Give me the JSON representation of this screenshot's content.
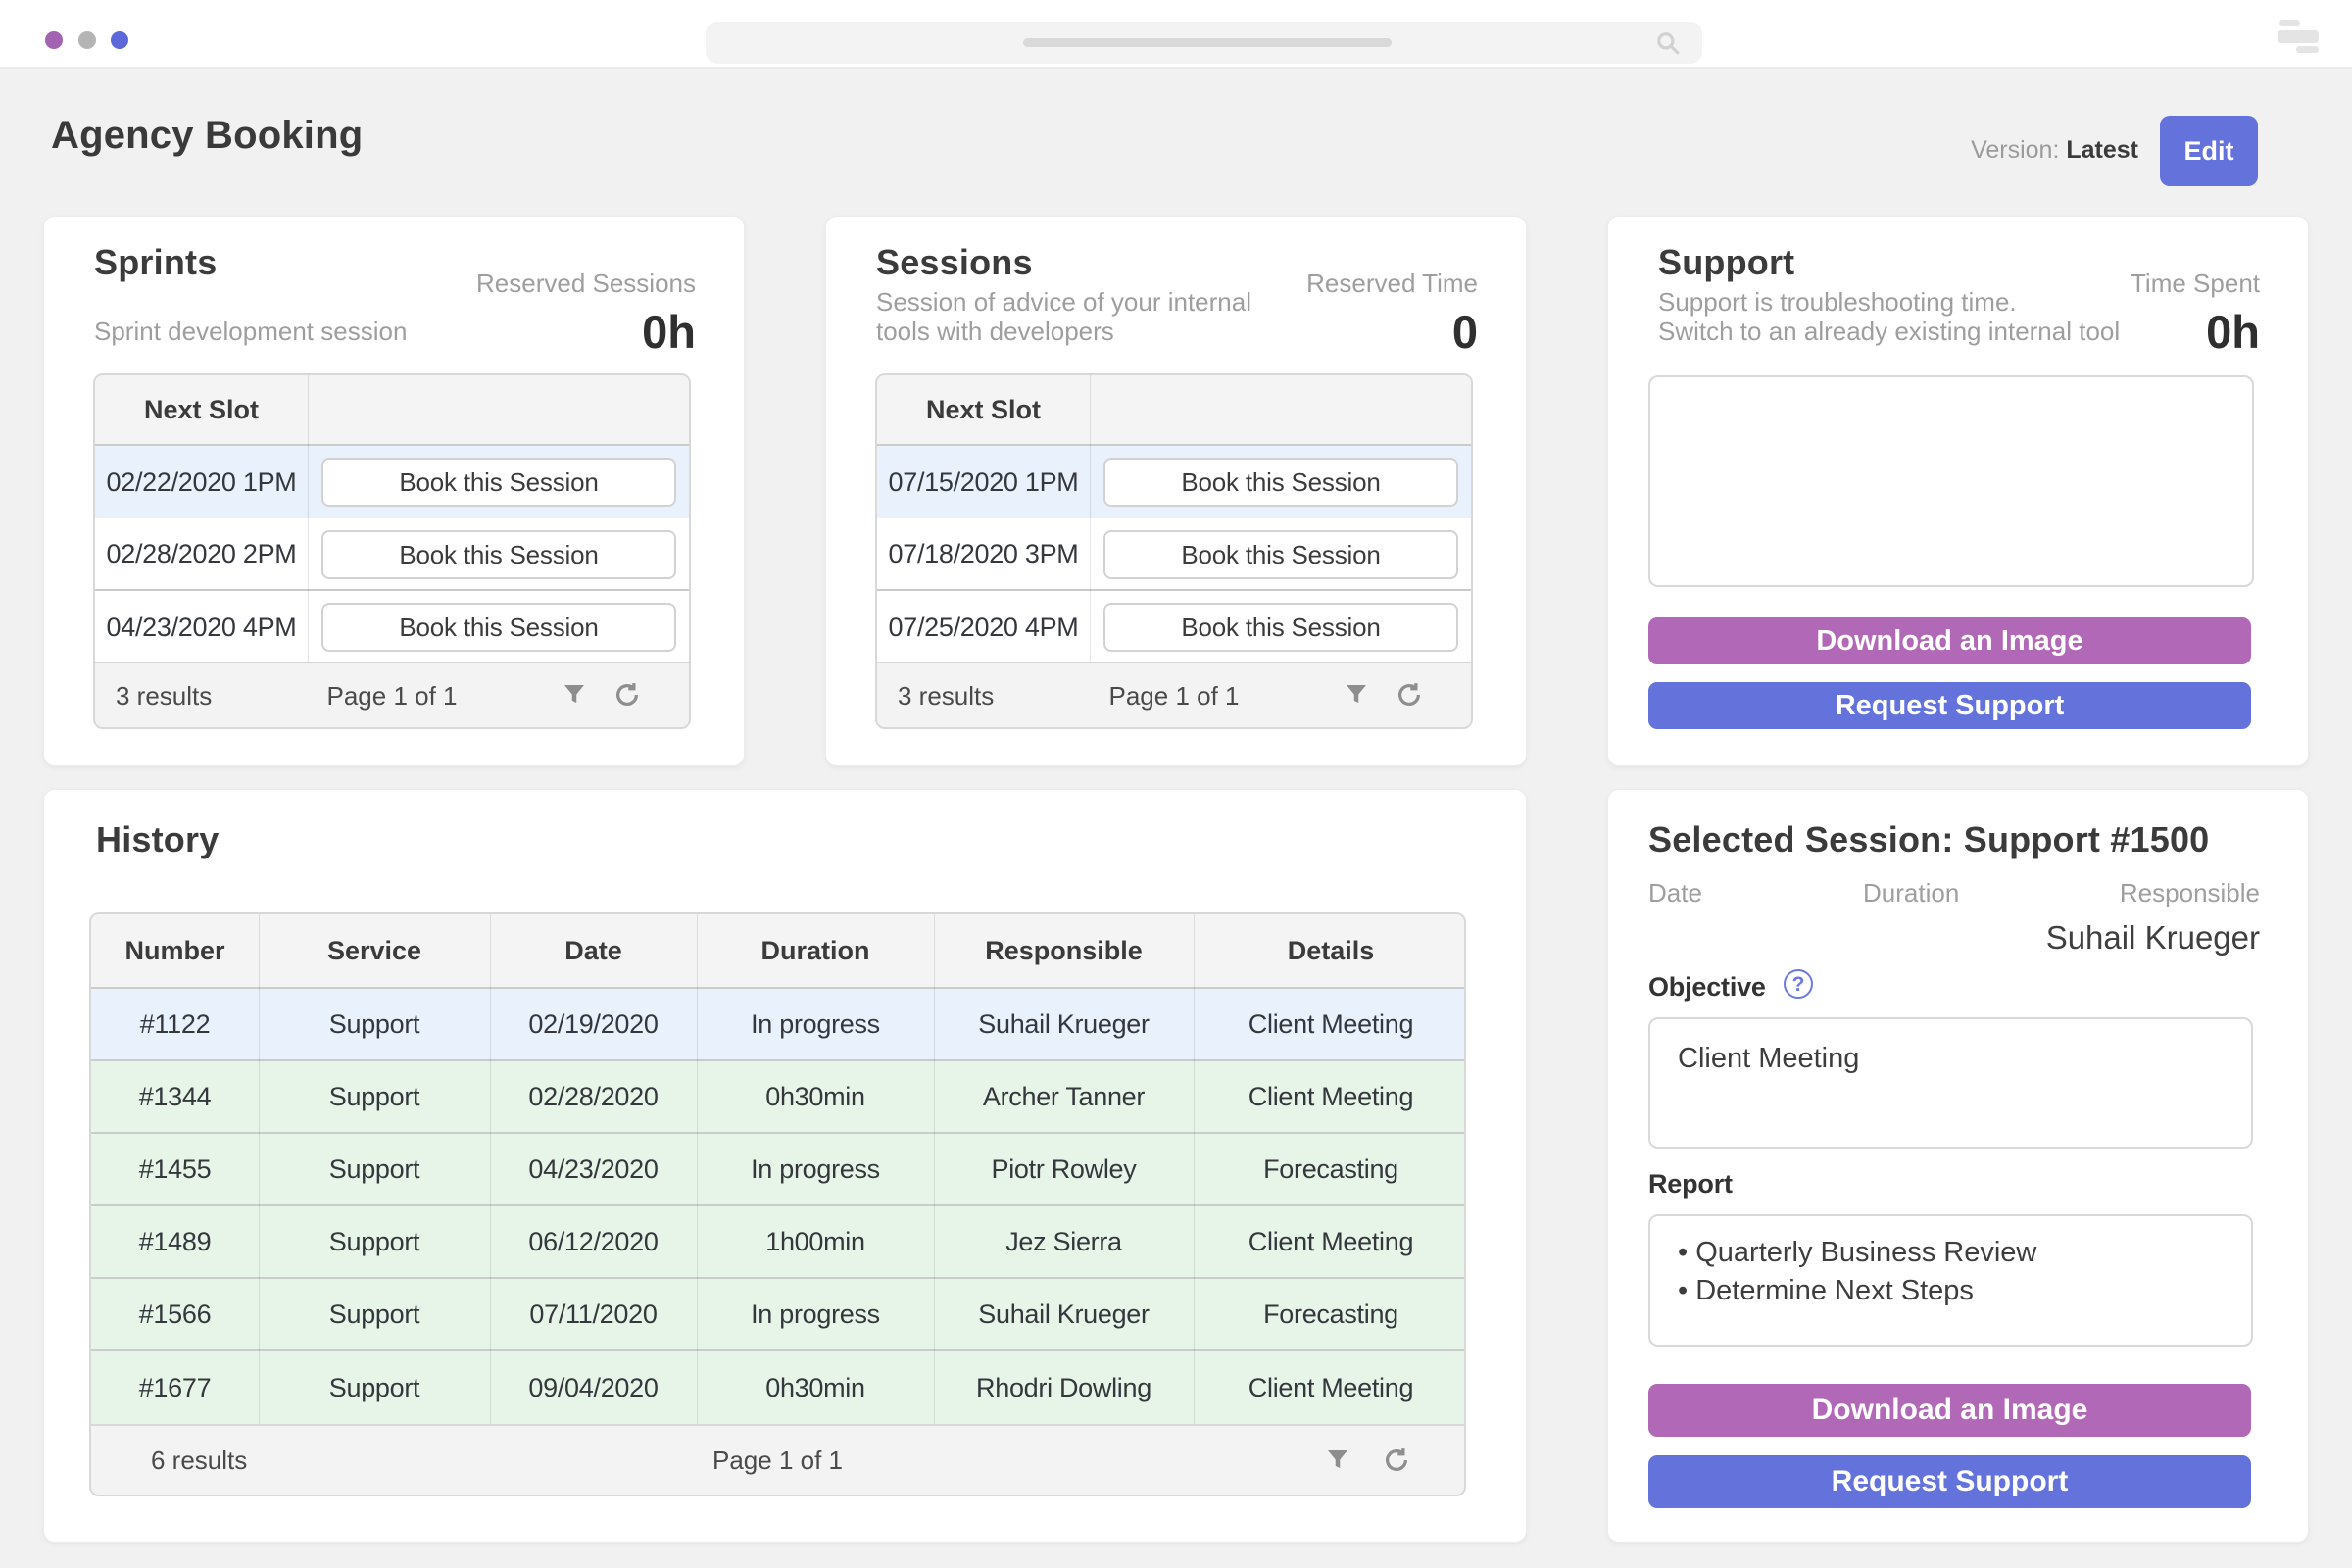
{
  "window": {
    "traffic_dots": [
      "purple-dot",
      "gray-dot",
      "indigo-dot"
    ],
    "search_placeholder_line": true
  },
  "colors": {
    "accent_indigo": "#6473dc",
    "accent_mauve": "#b168b7",
    "selected_row_blue": "#e9f1fc",
    "history_row_green": "#e7f5e9",
    "page_background": "#f1f1f2"
  },
  "header": {
    "title": "Agency Booking",
    "version_label": "Version:",
    "version_value": "Latest",
    "edit_button": "Edit"
  },
  "sprints": {
    "title": "Sprints",
    "kpi_label": "Reserved Sessions",
    "kpi_value": "0h",
    "subtitle": "Sprint development session",
    "table": {
      "column_header": "Next Slot",
      "book_button": "Book this Session",
      "slots": [
        "02/22/2020 1PM",
        "02/28/2020 2PM",
        "04/23/2020 4PM"
      ],
      "results": "3 results",
      "page": "Page 1 of 1"
    }
  },
  "sessions": {
    "title": "Sessions",
    "kpi_label": "Reserved Time",
    "kpi_value": "0",
    "subtitle_line1": "Session of advice of your internal",
    "subtitle_line2": "tools with developers",
    "table": {
      "column_header": "Next Slot",
      "book_button": "Book this Session",
      "slots": [
        "07/15/2020 1PM",
        "07/18/2020 3PM",
        "07/25/2020 4PM"
      ],
      "results": "3 results",
      "page": "Page 1 of 1"
    }
  },
  "support": {
    "title": "Support",
    "kpi_label": "Time Spent",
    "kpi_value": "0h",
    "subtitle_line1": "Support is troubleshooting time.",
    "subtitle_line2": "Switch to an already existing internal tool",
    "textarea_value": "",
    "download_button": "Download an Image",
    "request_button": "Request Support"
  },
  "history": {
    "title": "History",
    "columns": [
      "Number",
      "Service",
      "Date",
      "Duration",
      "Responsible",
      "Details"
    ],
    "rows": [
      [
        "#1122",
        "Support",
        "02/19/2020",
        "In progress",
        "Suhail Krueger",
        "Client Meeting"
      ],
      [
        "#1344",
        "Support",
        "02/28/2020",
        "0h30min",
        "Archer Tanner",
        "Client Meeting"
      ],
      [
        "#1455",
        "Support",
        "04/23/2020",
        "In progress",
        "Piotr Rowley",
        "Forecasting"
      ],
      [
        "#1489",
        "Support",
        "06/12/2020",
        "1h00min",
        "Jez Sierra",
        "Client Meeting"
      ],
      [
        "#1566",
        "Support",
        "07/11/2020",
        "In progress",
        "Suhail Krueger",
        "Forecasting"
      ],
      [
        "#1677",
        "Support",
        "09/04/2020",
        "0h30min",
        "Rhodri Dowling",
        "Client Meeting"
      ]
    ],
    "results": "6 results",
    "page": "Page 1 of 1"
  },
  "selected_session": {
    "title": "Selected Session: Support #1500",
    "date_label": "Date",
    "duration_label": "Duration",
    "responsible_label": "Responsible",
    "responsible_value": "Suhail Krueger",
    "objective_label": "Objective",
    "objective_value": "Client Meeting",
    "report_label": "Report",
    "report_items": [
      "Quarterly Business Review",
      "Determine Next Steps"
    ],
    "download_button": "Download an Image",
    "request_button": "Request Support"
  }
}
